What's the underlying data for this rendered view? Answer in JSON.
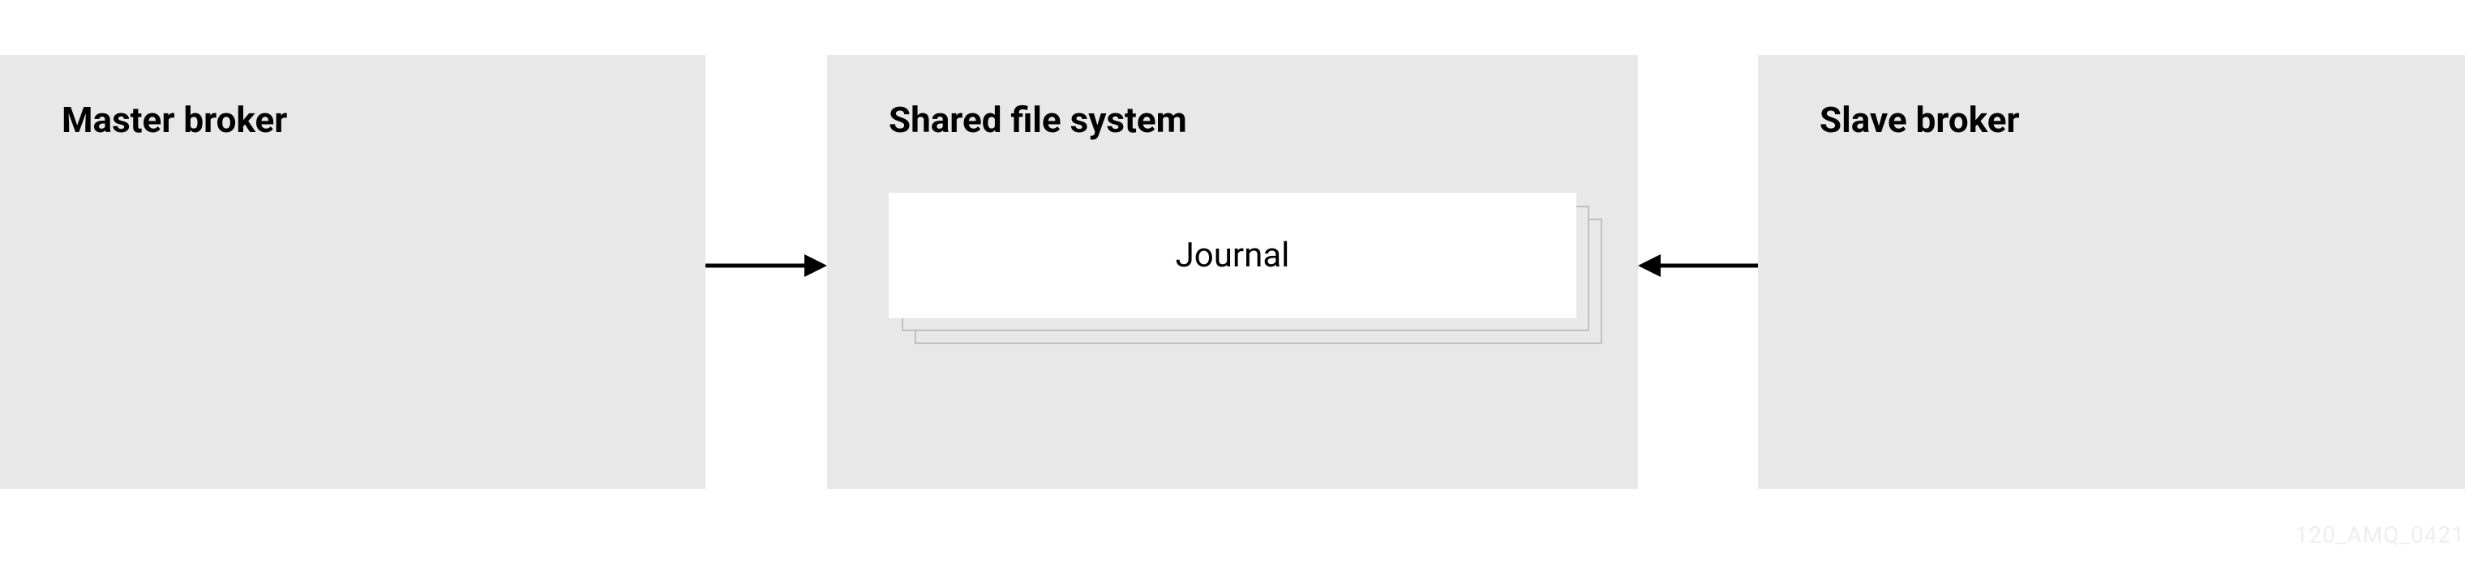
{
  "boxes": {
    "left": {
      "title": "Master broker"
    },
    "middle": {
      "title": "Shared file system",
      "journal": "Journal"
    },
    "right": {
      "title": "Slave broker"
    }
  },
  "watermark": "120_AMQ_0421"
}
